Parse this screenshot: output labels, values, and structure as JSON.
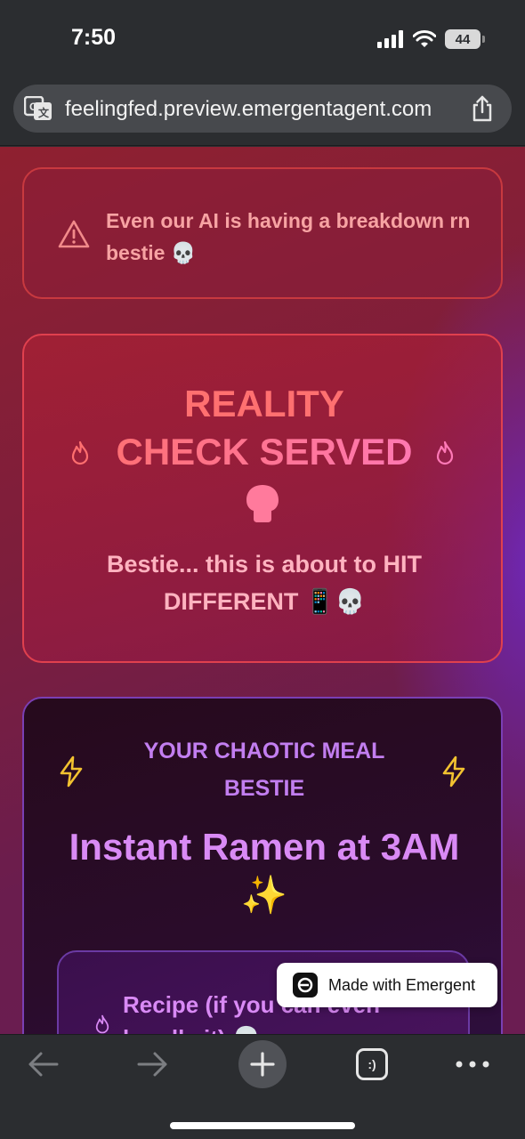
{
  "status_bar": {
    "time": "7:50",
    "battery": "44",
    "icons": [
      "signal-icon",
      "wifi-icon",
      "battery-icon"
    ]
  },
  "browser": {
    "url": "feelingfed.preview.emergentagent.com",
    "icons": [
      "translate-icon",
      "share-icon"
    ]
  },
  "alert": {
    "text": "Even our AI is having a breakdown rn bestie 💀",
    "icon": "warning-icon",
    "color": "#f7a3a3"
  },
  "reality_card": {
    "title_line1": "REALITY",
    "title_line2": "CHECK SERVED",
    "subtitle": "Bestie... this is about to HIT DIFFERENT 📱💀",
    "icons": [
      "flame-icon",
      "skull-icon"
    ]
  },
  "meal_card": {
    "label": "YOUR CHAOTIC MEAL BESTIE",
    "title": "Instant Ramen at 3AM ✨",
    "icons": [
      "lightning-icon"
    ],
    "recipe": {
      "text": "Recipe (if you can even handle it) 💀"
    }
  },
  "badge": {
    "text": "Made with Emergent"
  },
  "toolbar": {
    "tabs_label": ":)",
    "icons": [
      "back-arrow-icon",
      "forward-arrow-icon",
      "plus-icon",
      "tabs-icon",
      "more-icon"
    ]
  },
  "colors": {
    "accent_red": "#ff7070",
    "accent_purple": "#c27ef0",
    "bolt_yellow": "#f2c230"
  }
}
